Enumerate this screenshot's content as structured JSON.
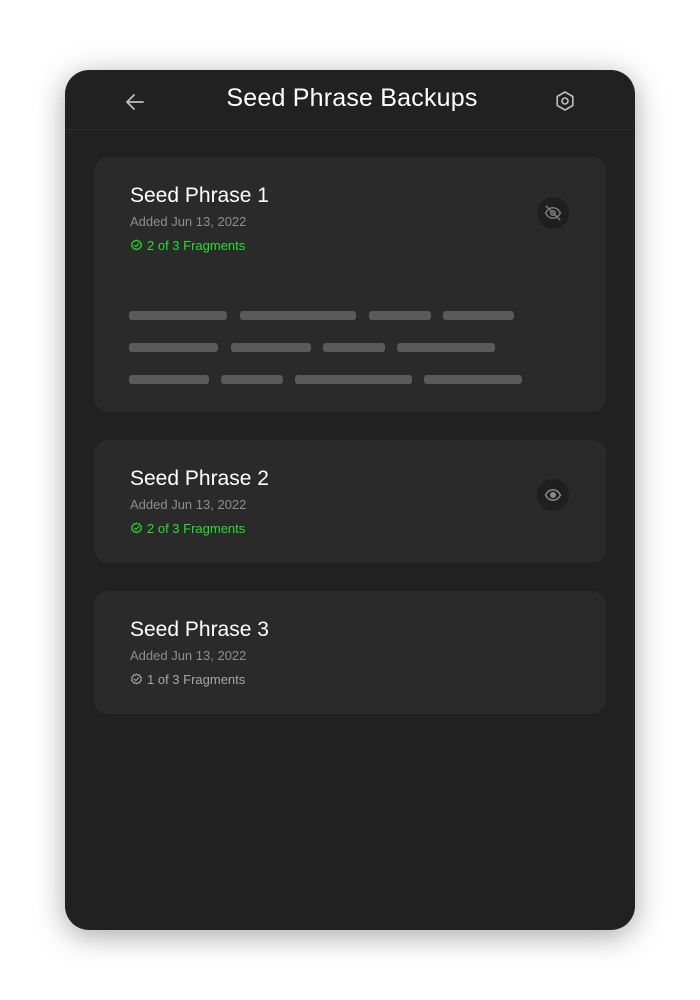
{
  "header": {
    "title": "Seed Phrase Backups",
    "back_icon": "arrow-left-icon",
    "settings_icon": "hexagon-settings-icon"
  },
  "colors": {
    "background": "#212121",
    "card": "#2a2a2a",
    "complete_green": "#22e02c",
    "muted": "#8e8e8e",
    "masked_word": "#5a5a5a"
  },
  "phrases": [
    {
      "title": "Seed Phrase 1",
      "date": "Added Jun 13, 2022",
      "fragments": "2 of 3 Fragments",
      "complete": true,
      "visibility_icon": "eye-off-icon",
      "expanded": true
    },
    {
      "title": "Seed Phrase 2",
      "date": "Added Jun 13, 2022",
      "fragments": "2 of 3 Fragments",
      "complete": true,
      "visibility_icon": "eye-icon",
      "expanded": false
    },
    {
      "title": "Seed Phrase 3",
      "date": "Added Jun 13, 2022",
      "fragments": "1 of 3 Fragments",
      "complete": false,
      "expanded": false
    }
  ]
}
